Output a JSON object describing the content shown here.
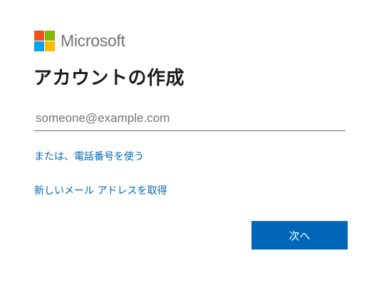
{
  "brand": {
    "name": "Microsoft",
    "logo_colors": [
      "#f25022",
      "#7fba00",
      "#00a4ef",
      "#ffb900"
    ]
  },
  "page": {
    "title": "アカウントの作成"
  },
  "email": {
    "value": "",
    "placeholder": "someone@example.com"
  },
  "links": {
    "phone": "または、電話番号を使う",
    "new_email": "新しいメール アドレスを取得"
  },
  "actions": {
    "next_label": "次へ",
    "accent_color": "#0067b8"
  }
}
